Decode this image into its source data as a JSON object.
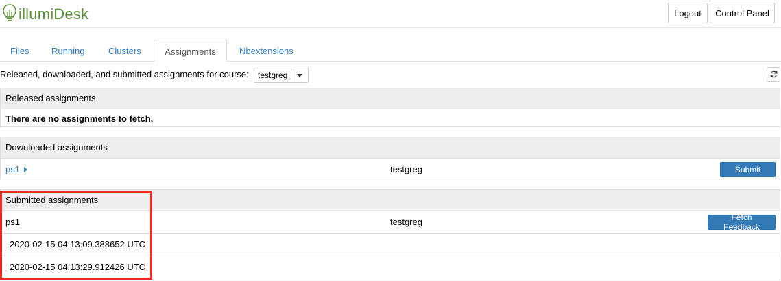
{
  "header": {
    "logo_text": "illumiDesk",
    "logout_label": "Logout",
    "control_panel_label": "Control Panel"
  },
  "tabs": [
    {
      "label": "Files",
      "active": false
    },
    {
      "label": "Running",
      "active": false
    },
    {
      "label": "Clusters",
      "active": false
    },
    {
      "label": "Assignments",
      "active": true
    },
    {
      "label": "Nbextensions",
      "active": false
    }
  ],
  "course": {
    "label": "Released, downloaded, and submitted assignments for course:",
    "selected": "testgreg"
  },
  "released": {
    "title": "Released assignments",
    "empty_message": "There are no assignments to fetch."
  },
  "downloaded": {
    "title": "Downloaded assignments",
    "items": [
      {
        "name": "ps1",
        "course": "testgreg",
        "action": "Submit"
      }
    ]
  },
  "submitted": {
    "title": "Submitted assignments",
    "name": "ps1",
    "course": "testgreg",
    "action": "Fetch Feedback",
    "timestamps": [
      "2020-02-15 04:13:09.388652 UTC",
      "2020-02-15 04:13:29.912426 UTC"
    ]
  },
  "colors": {
    "accent": "#337ab7",
    "brand": "#5b8f3a",
    "highlight": "#ee2a24"
  }
}
